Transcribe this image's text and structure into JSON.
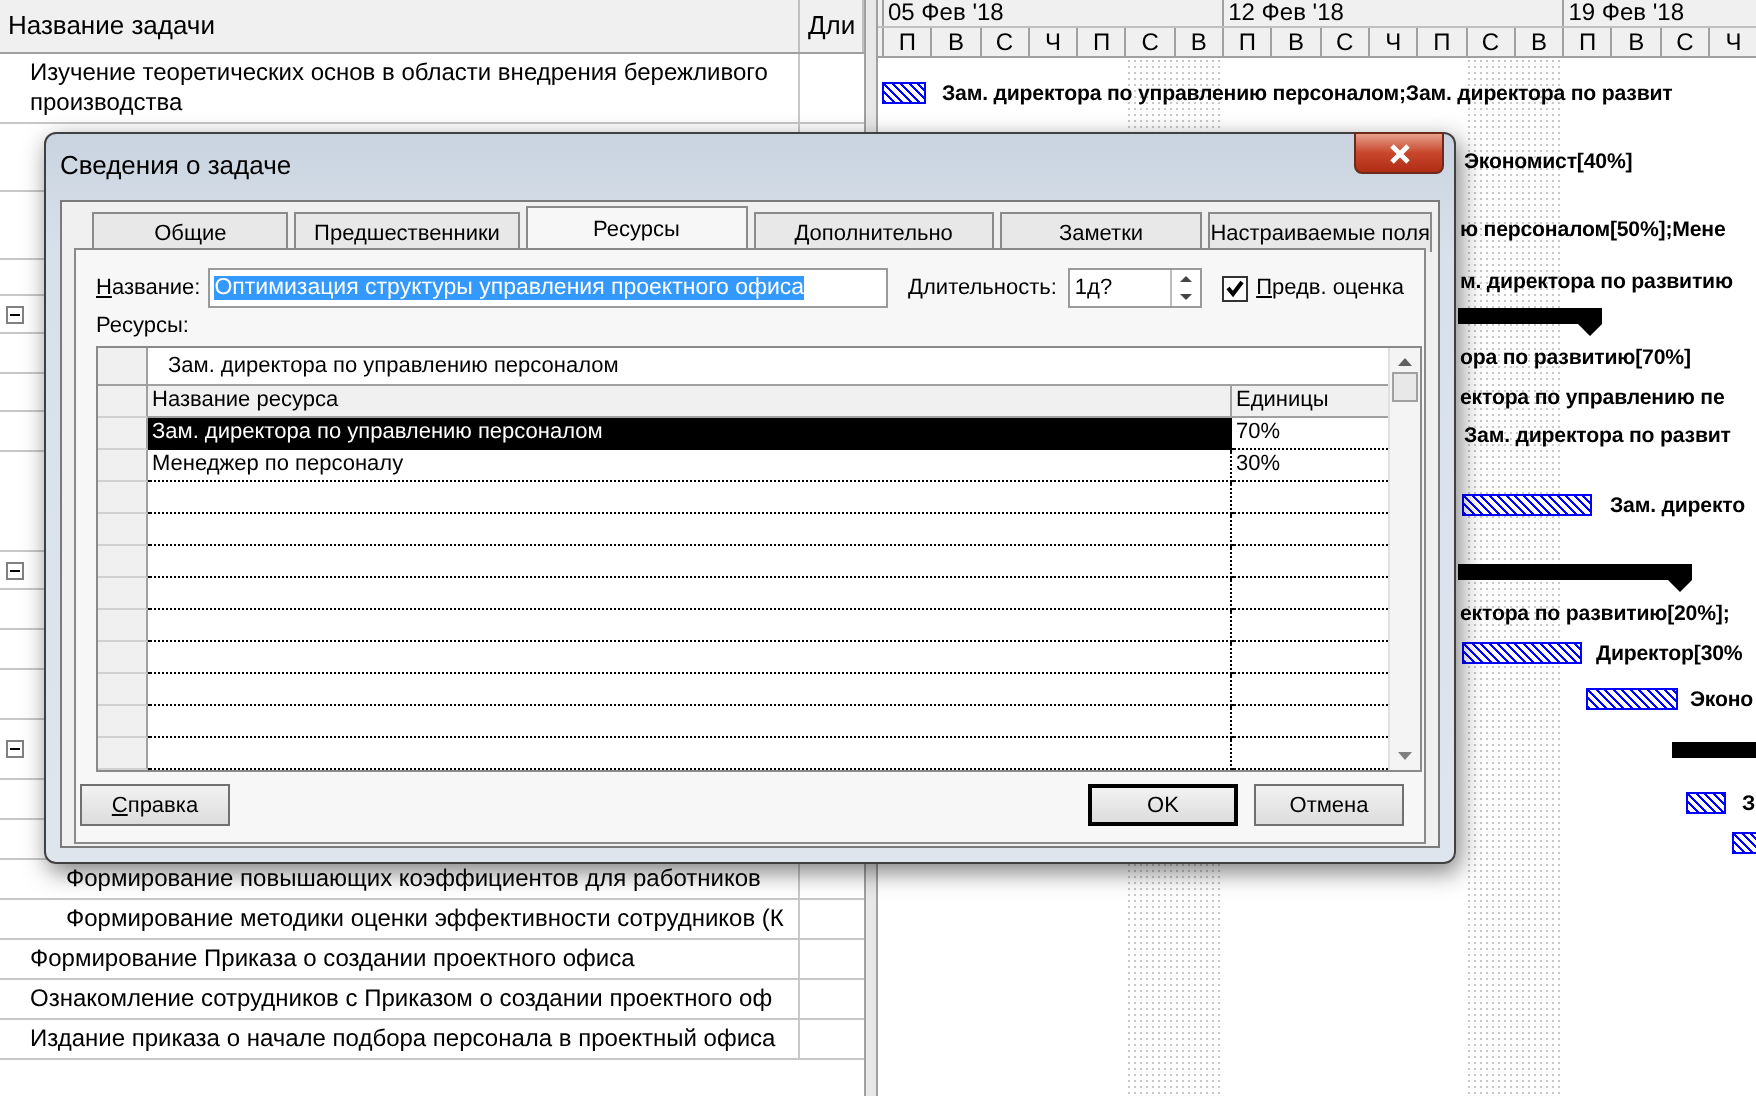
{
  "task_table": {
    "columns": [
      {
        "label": "Название задачи"
      },
      {
        "label": "Дли"
      }
    ]
  },
  "timescale": {
    "weeks": [
      {
        "label": "05 Фев '18",
        "days": [
          "П",
          "В",
          "С",
          "Ч",
          "П",
          "С",
          "В"
        ]
      },
      {
        "label": "12 Фев '18",
        "days": [
          "П",
          "В",
          "С",
          "Ч",
          "П",
          "С",
          "В"
        ]
      },
      {
        "label": "19 Фев '18",
        "days": [
          "П",
          "В",
          "С",
          "Ч"
        ]
      }
    ]
  },
  "rows": [
    {
      "kind": "task",
      "name": "Изучение теоретических основ в области внедрения бережливого производства",
      "bar": {
        "kind": "task",
        "label": "Зам. директора по управлению персоналом;Зам. директора по развит"
      }
    },
    {
      "kind": "task",
      "bar": {
        "kind": "label",
        "label": "Экономист[40%]"
      }
    },
    {
      "kind": "task",
      "bar": {
        "kind": "label",
        "label": "ю персоналом[50%];Мене"
      }
    },
    {
      "kind": "task",
      "bar": {
        "kind": "label",
        "label": "м. директора по развитию"
      }
    },
    {
      "kind": "summary",
      "expanded": true,
      "bar": {
        "kind": "summary"
      }
    },
    {
      "kind": "task",
      "bar": {
        "kind": "label",
        "label": "ора по развитию[70%]"
      }
    },
    {
      "kind": "task",
      "bar": {
        "kind": "label",
        "label": "ектора по управлению пе"
      }
    },
    {
      "kind": "task",
      "bar": {
        "kind": "label",
        "label": "Зам. директора по развит"
      }
    },
    {
      "kind": "task",
      "bar": {
        "kind": "task",
        "label": "Зам. директо"
      }
    },
    {
      "kind": "summary",
      "expanded": true,
      "bar": {
        "kind": "summary"
      }
    },
    {
      "kind": "task",
      "bar": {
        "kind": "label",
        "label": "ектора по развитию[20%];"
      }
    },
    {
      "kind": "task",
      "bar": {
        "kind": "task",
        "label": "Директор[30%"
      }
    },
    {
      "kind": "task",
      "bar": {
        "kind": "task",
        "label": "Эконо"
      }
    },
    {
      "kind": "summary",
      "expanded": true,
      "bar": {
        "kind": "summary"
      }
    },
    {
      "kind": "task",
      "bar": {
        "kind": "task",
        "label": "З"
      }
    },
    {
      "kind": "task",
      "bar": {
        "kind": "task"
      }
    },
    {
      "kind": "subtask",
      "name": "Формирование повышающих коэффициентов для работников"
    },
    {
      "kind": "subtask",
      "name": "Формирование методики оценки эффективности сотрудников (К"
    },
    {
      "kind": "task",
      "name": "Формирование Приказа о создании проектного офиса"
    },
    {
      "kind": "task",
      "name": "Ознакомление сотрудников с Приказом о создании проектного оф"
    },
    {
      "kind": "task",
      "name": "Издание приказа о начале подбора персонала в проектный офиса"
    }
  ],
  "dialog": {
    "title": "Сведения о задаче",
    "tabs": [
      {
        "label": "Общие",
        "selected": false
      },
      {
        "label": "Предшественники",
        "selected": false
      },
      {
        "label": "Ресурсы",
        "selected": true
      },
      {
        "label": "Дополнительно",
        "selected": false
      },
      {
        "label": "Заметки",
        "selected": false
      },
      {
        "label": "Настраиваемые поля",
        "selected": false
      }
    ],
    "name_field": {
      "label": "Название:",
      "value": "Оптимизация структуры управления проектного офиса",
      "selected": true
    },
    "duration_field": {
      "label": "Длительность:",
      "value": "1д?"
    },
    "estimate": {
      "label": "Предв. оценка",
      "checked": true
    },
    "resources_label": "Ресурсы:",
    "edit_value": "Зам. директора по управлению персоналом",
    "grid": {
      "columns": [
        "Название ресурса",
        "Единицы"
      ],
      "rows": [
        {
          "name": "Зам. директора по управлению персоналом",
          "units": "70%",
          "selected": true
        },
        {
          "name": "Менеджер по персоналу",
          "units": "30%",
          "selected": false
        }
      ]
    },
    "buttons": [
      {
        "kind": "help",
        "label": "Справка",
        "default": false
      },
      {
        "kind": "ok",
        "label": "OK",
        "default": true
      },
      {
        "kind": "cancel",
        "label": "Отмена",
        "default": false
      }
    ]
  }
}
